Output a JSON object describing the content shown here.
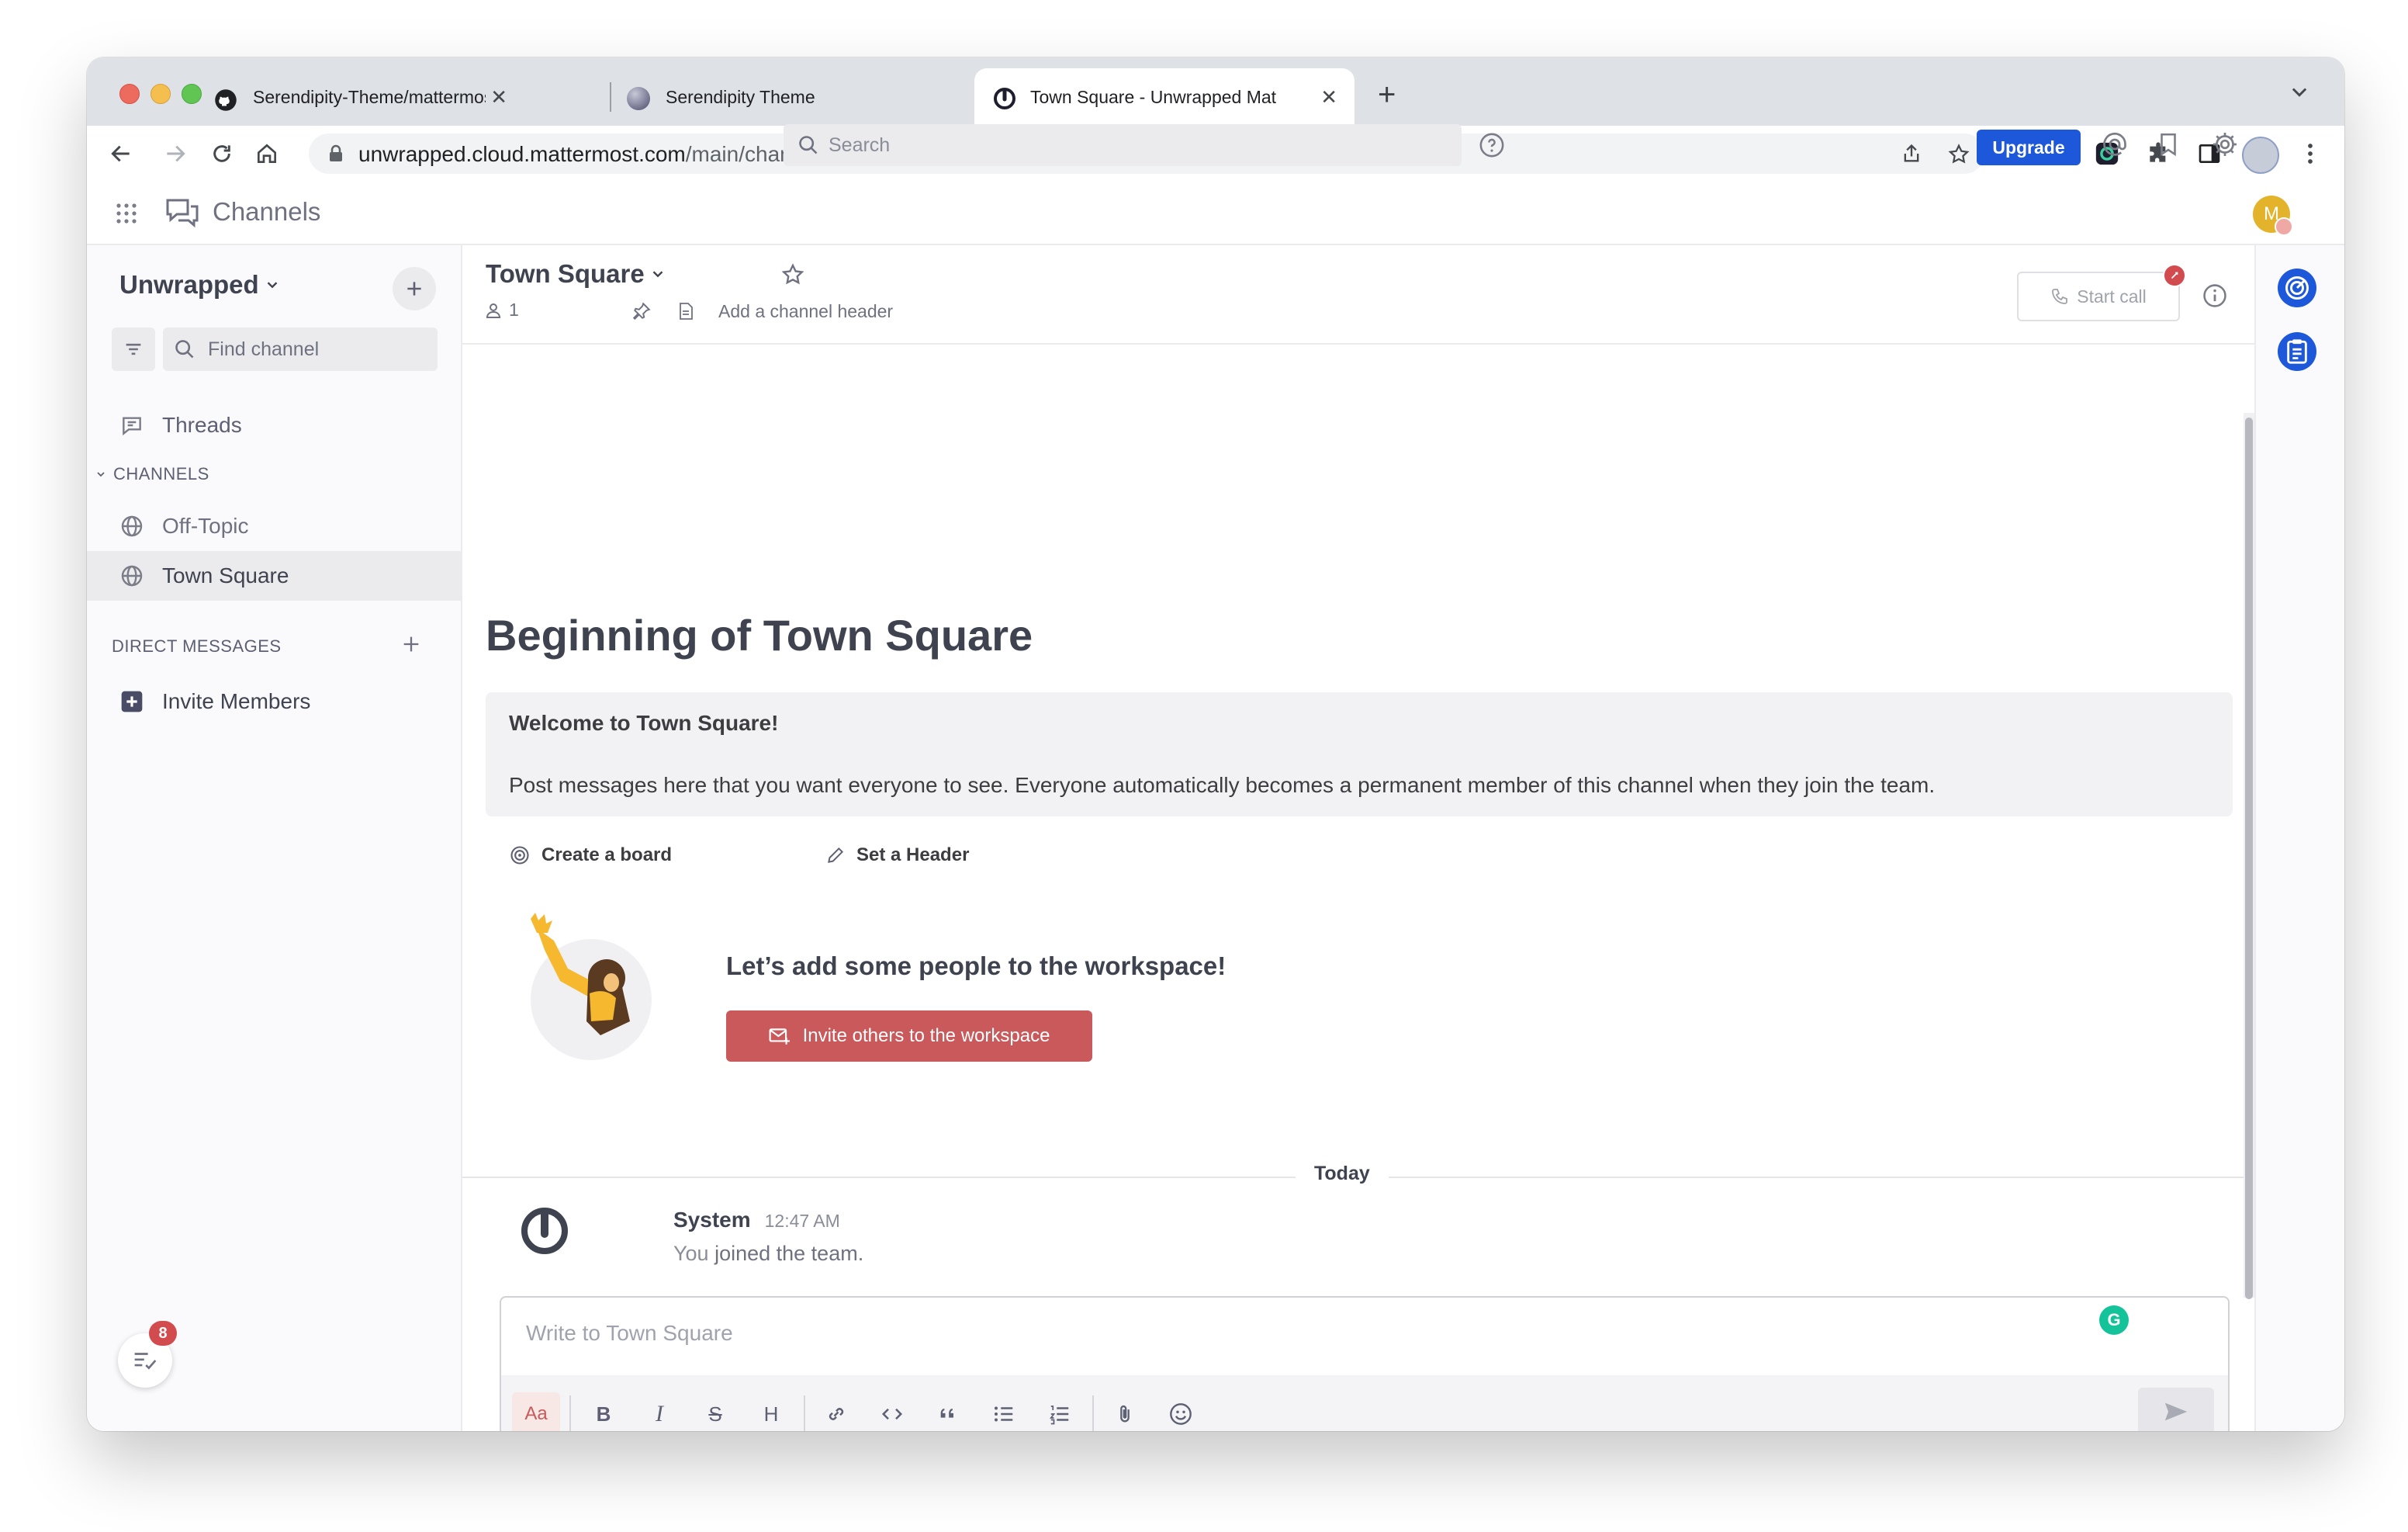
{
  "browser": {
    "tabs": [
      {
        "title": "Serendipity-Theme/mattermos",
        "icon": "github-icon",
        "active": false
      },
      {
        "title": "Serendipity Theme",
        "icon": "globe-theme-icon",
        "active": false
      },
      {
        "title": "Town Square - Unwrapped Mat",
        "icon": "mattermost-icon",
        "active": true
      }
    ],
    "url_host": "unwrapped.cloud.mattermost.com",
    "url_path": "/main/channels/town-square"
  },
  "header": {
    "product_name": "Channels",
    "search_placeholder": "Search",
    "upgrade_label": "Upgrade",
    "avatar_initial": "M"
  },
  "sidebar": {
    "team_name": "Unwrapped",
    "find_channel_placeholder": "Find channel",
    "threads_label": "Threads",
    "channels_header": "CHANNELS",
    "channels": [
      {
        "label": "Off-Topic",
        "active": false
      },
      {
        "label": "Town Square",
        "active": true
      }
    ],
    "dm_header": "DIRECT MESSAGES",
    "invite_members_label": "Invite Members",
    "todo_badge": "8"
  },
  "channel": {
    "name": "Town Square",
    "member_count": "1",
    "add_header_text": "Add a channel header",
    "start_call_label": "Start call",
    "intro_title": "Beginning of Town Square",
    "welcome_title": "Welcome to Town Square!",
    "welcome_body": "Post messages here that you want everyone to see. Everyone automatically becomes a permanent member of this channel when they join the team.",
    "action_create_board": "Create a board",
    "action_set_header": "Set a Header",
    "add_people_title": "Let’s add some people to the workspace!",
    "invite_button_label": "Invite others to the workspace",
    "date_separator": "Today",
    "post": {
      "author": "System",
      "time": "12:47 AM",
      "message_prefix": "You ",
      "message_rest": "joined the team."
    },
    "composer_placeholder": "Write to Town Square"
  },
  "colors": {
    "accent": "#1c58d9",
    "invite_button": "#c9595b",
    "badge": "#d24b4e",
    "sidebar_bg": "#fafafc"
  }
}
